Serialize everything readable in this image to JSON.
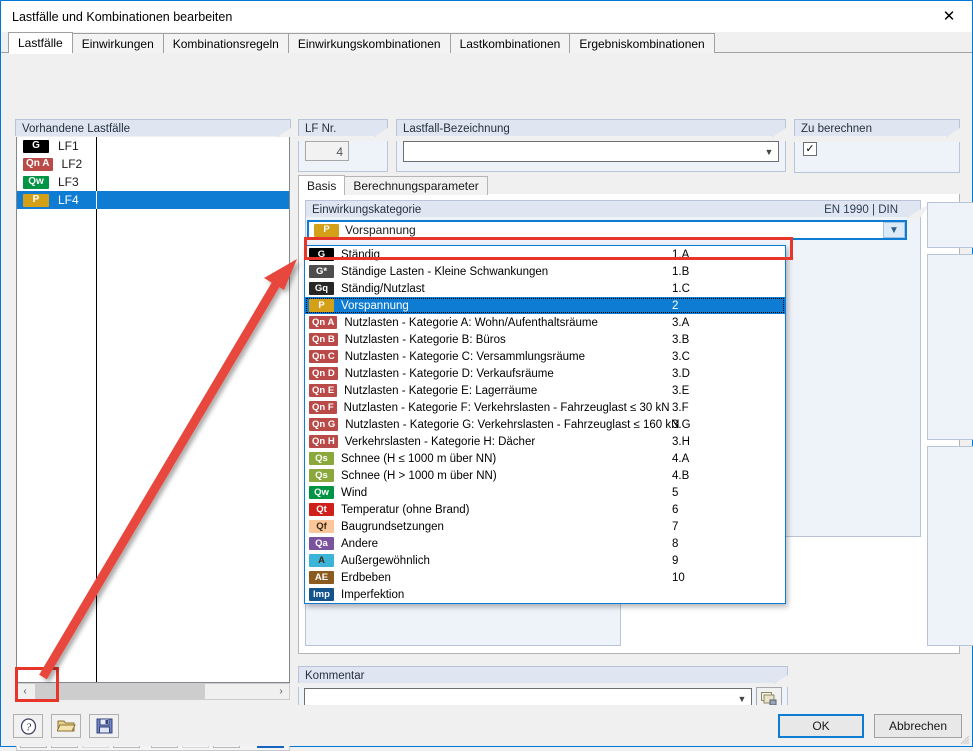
{
  "window": {
    "title": "Lastfälle und Kombinationen bearbeiten",
    "close_icon": "close-icon",
    "accent_color": "#0078d7"
  },
  "tabs": [
    {
      "label": "Lastfälle",
      "active": true
    },
    {
      "label": "Einwirkungen",
      "active": false
    },
    {
      "label": "Kombinationsregeln",
      "active": false
    },
    {
      "label": "Einwirkungskombinationen",
      "active": false
    },
    {
      "label": "Lastkombinationen",
      "active": false
    },
    {
      "label": "Ergebniskombinationen",
      "active": false
    }
  ],
  "left_panel": {
    "title": "Vorhandene Lastfälle",
    "rows": [
      {
        "badge": "G",
        "badge_color": "#000000",
        "badge_text_color": "#ffffff",
        "name": "LF1",
        "selected": false
      },
      {
        "badge": "Qn A",
        "badge_color": "#b94a48",
        "badge_text_color": "#ffffff",
        "name": "LF2",
        "selected": false
      },
      {
        "badge": "Qw",
        "badge_color": "#009444",
        "badge_text_color": "#ffffff",
        "name": "LF3",
        "selected": false
      },
      {
        "badge": "P",
        "badge_color": "#d4a017",
        "badge_text_color": "#ffffff",
        "name": "LF4",
        "selected": true
      }
    ],
    "scrollbar": {
      "left_arrow": "‹",
      "right_arrow": "›"
    },
    "toolbar": [
      {
        "name": "new-load-case-button",
        "icon": "new-window-icon",
        "enabled": true,
        "highlighted": true
      },
      {
        "name": "copy-load-case-button",
        "icon": "copy-window-icon",
        "enabled": true,
        "highlighted": false
      },
      {
        "name": "transfer-load-case-button",
        "icon": "transfer-icon",
        "enabled": false,
        "highlighted": false
      },
      {
        "name": "rename-load-case-button",
        "icon": "rename-text-icon",
        "enabled": true,
        "highlighted": false
      },
      {
        "name": "select-all-button",
        "icon": "checklist-icon",
        "enabled": true,
        "highlighted": false
      },
      {
        "name": "deselect-all-button",
        "icon": "uncheck-list-icon",
        "enabled": false,
        "highlighted": false
      },
      {
        "name": "edit-list-button",
        "icon": "edit-list-icon",
        "enabled": true,
        "highlighted": false
      },
      {
        "name": "delete-load-case-button",
        "icon": "delete-cross-icon",
        "enabled": true,
        "highlighted": false
      }
    ]
  },
  "lf_nr": {
    "title": "LF Nr.",
    "value": "4"
  },
  "designation": {
    "title": "Lastfall-Bezeichnung",
    "value": "",
    "dropdown_icon": "chevron-down-icon"
  },
  "to_calculate": {
    "title": "Zu berechnen",
    "checked": true,
    "check_glyph": "✓"
  },
  "inner_tabs": [
    {
      "label": "Basis",
      "active": true
    },
    {
      "label": "Berechnungsparameter",
      "active": false
    }
  ],
  "action_category": {
    "title": "Einwirkungskategorie",
    "standard": "EN 1990 | DIN",
    "selected": {
      "badge": "P",
      "badge_color": "#d4a017",
      "label": "Vorspannung",
      "code": "2"
    },
    "dropdown_icon": "chevron-down-icon",
    "options": [
      {
        "badge": "G",
        "badge_color": "#000000",
        "label": "Ständig",
        "code": "1.A",
        "selected": false
      },
      {
        "badge": "G*",
        "badge_color": "#4d4d4d",
        "label": "Ständige Lasten - Kleine Schwankungen",
        "code": "1.B",
        "selected": false
      },
      {
        "badge": "Gq",
        "badge_color": "#262626",
        "label": "Ständig/Nutzlast",
        "code": "1.C",
        "selected": false
      },
      {
        "badge": "P",
        "badge_color": "#d4a017",
        "label": "Vorspannung",
        "code": "2",
        "selected": true
      },
      {
        "badge": "Qn A",
        "badge_color": "#b94a48",
        "label": "Nutzlasten - Kategorie A: Wohn/Aufenthaltsräume",
        "code": "3.A",
        "selected": false
      },
      {
        "badge": "Qn B",
        "badge_color": "#b94a48",
        "label": "Nutzlasten - Kategorie B: Büros",
        "code": "3.B",
        "selected": false
      },
      {
        "badge": "Qn C",
        "badge_color": "#b94a48",
        "label": "Nutzlasten - Kategorie C: Versammlungsräume",
        "code": "3.C",
        "selected": false
      },
      {
        "badge": "Qn D",
        "badge_color": "#b94a48",
        "label": "Nutzlasten - Kategorie D: Verkaufsräume",
        "code": "3.D",
        "selected": false
      },
      {
        "badge": "Qn E",
        "badge_color": "#b94a48",
        "label": "Nutzlasten - Kategorie E: Lagerräume",
        "code": "3.E",
        "selected": false
      },
      {
        "badge": "Qn F",
        "badge_color": "#b94a48",
        "label": "Nutzlasten - Kategorie F: Verkehrslasten - Fahrzeuglast ≤ 30 kN",
        "code": "3.F",
        "selected": false
      },
      {
        "badge": "Qn G",
        "badge_color": "#b94a48",
        "label": "Nutzlasten - Kategorie G: Verkehrslasten - Fahrzeuglast ≤ 160 kN",
        "code": "3.G",
        "selected": false
      },
      {
        "badge": "Qn H",
        "badge_color": "#b94a48",
        "label": "Verkehrslasten - Kategorie H: Dächer",
        "code": "3.H",
        "selected": false
      },
      {
        "badge": "Qs",
        "badge_color": "#8aa83c",
        "label": "Schnee (H ≤ 1000 m über NN)",
        "code": "4.A",
        "selected": false
      },
      {
        "badge": "Qs",
        "badge_color": "#8aa83c",
        "label": "Schnee (H > 1000 m über NN)",
        "code": "4.B",
        "selected": false
      },
      {
        "badge": "Qw",
        "badge_color": "#009444",
        "label": "Wind",
        "code": "5",
        "selected": false
      },
      {
        "badge": "Qt",
        "badge_color": "#d0201c",
        "label": "Temperatur (ohne Brand)",
        "code": "6",
        "selected": false
      },
      {
        "badge": "Qf",
        "badge_color": "#fbc79a",
        "label": "Baugrundsetzungen",
        "code": "7",
        "selected": false
      },
      {
        "badge": "Qa",
        "badge_color": "#7b529e",
        "label": "Andere",
        "code": "8",
        "selected": false
      },
      {
        "badge": "A",
        "badge_color": "#3bb4d8",
        "label": "Außergewöhnlich",
        "code": "9",
        "selected": false
      },
      {
        "badge": "AE",
        "badge_color": "#8b5a1e",
        "label": "Erdbeben",
        "code": "10",
        "selected": false
      },
      {
        "badge": "Imp",
        "badge_color": "#14538c",
        "label": "Imperfektion",
        "code": "",
        "selected": false
      }
    ]
  },
  "comment": {
    "title": "Kommentar",
    "value": "",
    "dropdown_icon": "chevron-down-icon",
    "button_icon": "copy-stack-icon"
  },
  "footer": {
    "help_icon": "help-question-icon",
    "open_icon": "open-folder-icon",
    "save_icon": "floppy-save-icon",
    "ok_label": "OK",
    "cancel_label": "Abbrechen"
  },
  "annotations": {
    "highlight_color": "#e8352a",
    "arrow_from": "new-load-case-button",
    "arrow_to": "selected-dropdown-option"
  }
}
